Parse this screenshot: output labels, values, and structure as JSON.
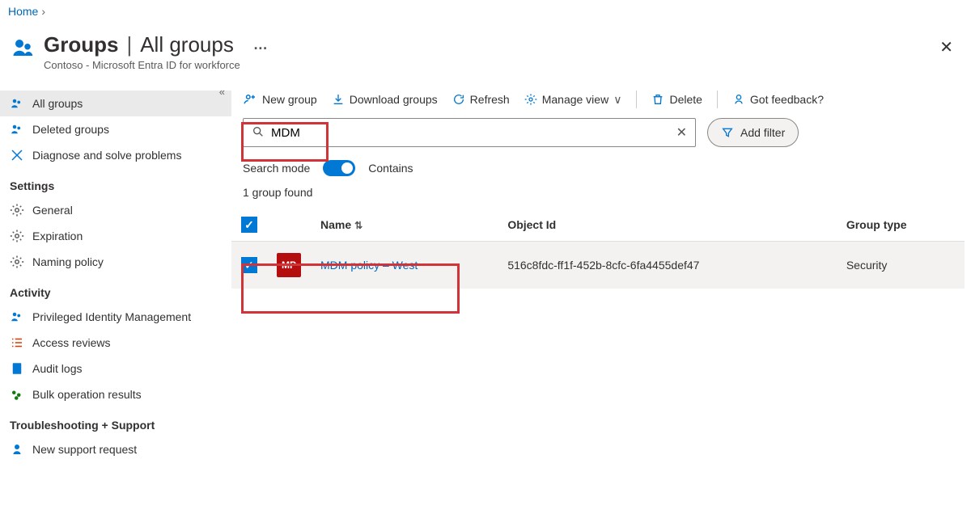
{
  "breadcrumb": {
    "home": "Home"
  },
  "header": {
    "title_main": "Groups",
    "title_sub": "All groups",
    "more": "…",
    "subtitle": "Contoso - Microsoft Entra ID for workforce"
  },
  "sidebar": {
    "items": [
      {
        "label": "All groups"
      },
      {
        "label": "Deleted groups"
      },
      {
        "label": "Diagnose and solve problems"
      }
    ],
    "headings": {
      "settings": "Settings",
      "activity": "Activity",
      "troubleshooting": "Troubleshooting + Support"
    },
    "settings_items": [
      {
        "label": "General"
      },
      {
        "label": "Expiration"
      },
      {
        "label": "Naming policy"
      }
    ],
    "activity_items": [
      {
        "label": "Privileged Identity Management"
      },
      {
        "label": "Access reviews"
      },
      {
        "label": "Audit logs"
      },
      {
        "label": "Bulk operation results"
      }
    ],
    "troubleshooting_items": [
      {
        "label": "New support request"
      }
    ]
  },
  "commands": {
    "new_group": "New group",
    "download": "Download groups",
    "refresh": "Refresh",
    "manage_view": "Manage view",
    "delete": "Delete",
    "feedback": "Got feedback?"
  },
  "search": {
    "value": "MDM",
    "mode_label": "Search mode",
    "mode_value": "Contains",
    "found_text": "1 group found",
    "filter_label": "Add filter"
  },
  "table": {
    "headers": {
      "name": "Name",
      "object_id": "Object Id",
      "group_type": "Group type"
    },
    "rows": [
      {
        "badge": "MP",
        "name": "MDM policy – West",
        "object_id": "516c8fdc-ff1f-452b-8cfc-6fa4455def47",
        "group_type": "Security",
        "selected": true
      }
    ]
  }
}
